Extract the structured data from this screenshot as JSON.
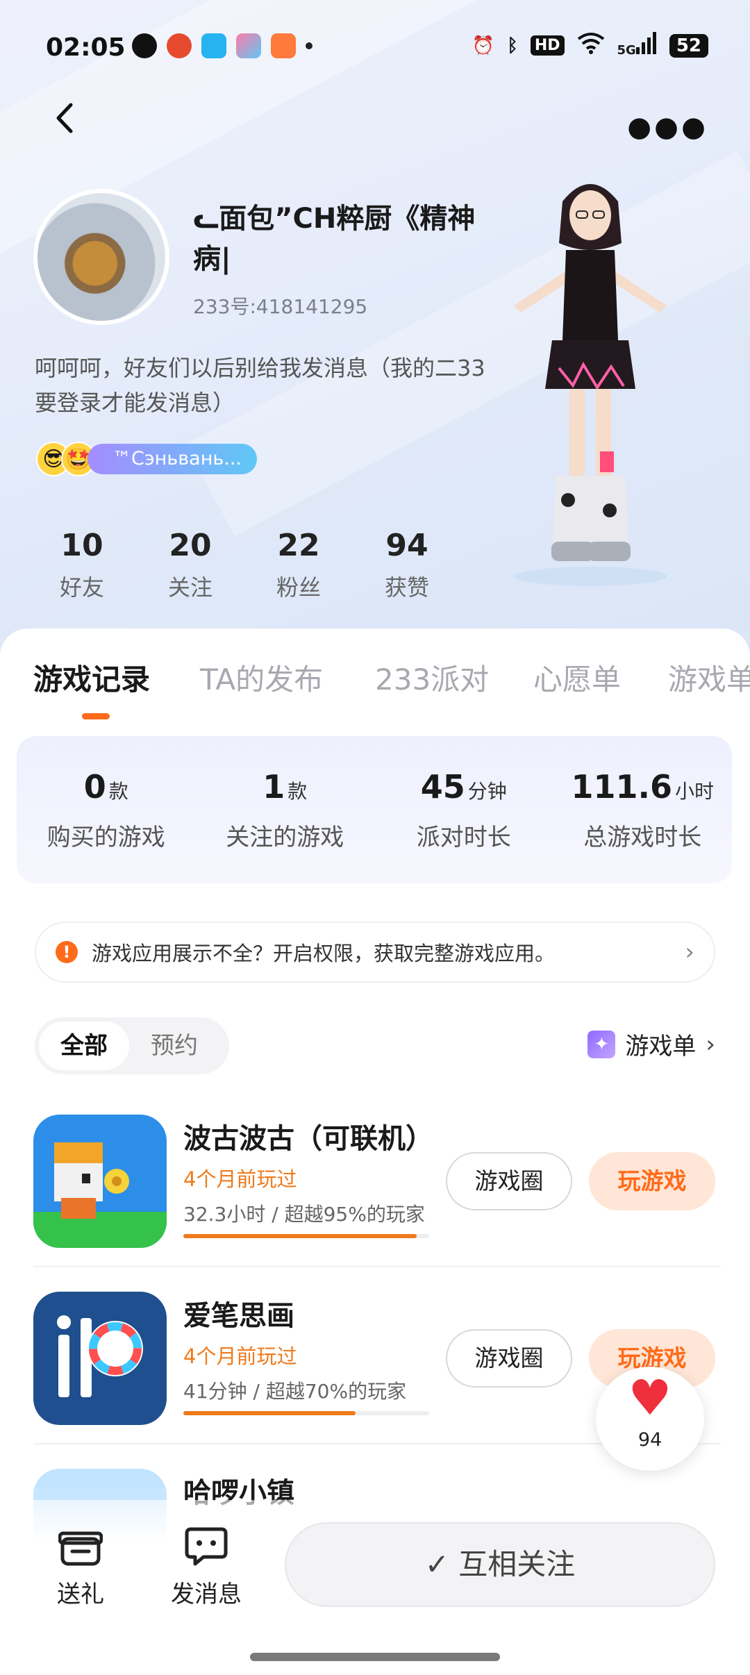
{
  "status_bar": {
    "time": "02:05",
    "network": "5G",
    "hd": "HD",
    "battery": "52"
  },
  "profile": {
    "nickname": "ᓚ面包”CH粹厨《精神病|",
    "uid": "233号:418141295",
    "bio": "呵呵呵，好友们以后别给我发消息（我的二33要登录才能发消息）",
    "badge_text": "™Сэньвань...",
    "stats": [
      {
        "value": "10",
        "label": "好友"
      },
      {
        "value": "20",
        "label": "关注"
      },
      {
        "value": "22",
        "label": "粉丝"
      },
      {
        "value": "94",
        "label": "获赞"
      }
    ]
  },
  "tabs": [
    "游戏记录",
    "TA的发布",
    "233派对",
    "心愿单",
    "游戏单"
  ],
  "summary": [
    {
      "value": "0",
      "unit": "款",
      "label": "购买的游戏"
    },
    {
      "value": "1",
      "unit": "款",
      "label": "关注的游戏"
    },
    {
      "value": "45",
      "unit": "分钟",
      "label": "派对时长"
    },
    {
      "value": "111.6",
      "unit": "小时",
      "label": "总游戏时长"
    }
  ],
  "notice": {
    "text": "游戏应用展示不全？开启权限，获取完整游戏应用。"
  },
  "filter": {
    "all": "全部",
    "reserve": "预约",
    "game_list": "游戏单"
  },
  "games": [
    {
      "name": "波古波古（可联机）",
      "played": "4个月前玩过",
      "stat": "32.3小时 / 超越95%的玩家",
      "progress": 0.95,
      "circle": "游戏圈",
      "play": "玩游戏"
    },
    {
      "name": "爱笔思画",
      "played": "4个月前玩过",
      "stat": "41分钟 / 超越70%的玩家",
      "progress": 0.7,
      "circle": "游戏圈",
      "play": "玩游戏"
    },
    {
      "name": "哈啰小镇"
    }
  ],
  "likes": {
    "count": "94"
  },
  "bottom": {
    "gift": "送礼",
    "message": "发消息",
    "follow": "互相关注"
  }
}
